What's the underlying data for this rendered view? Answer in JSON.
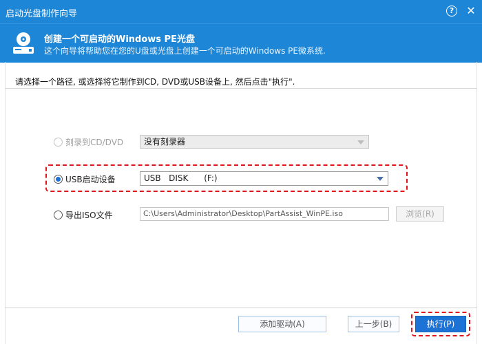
{
  "window": {
    "title": "启动光盘制作向导",
    "help_label": "?",
    "close_label": "✕"
  },
  "header": {
    "title": "创建一个可启动的Windows PE光盘",
    "subtitle": "这个向导将帮助您在您的U盘或光盘上创建一个可启动的Windows PE微系统.",
    "icon": "disc-drive-icon"
  },
  "instruction": "请选择一个路径, 或选择将它制作到CD, DVD或USB设备上, 然后点击\"执行\".",
  "options": {
    "cd_dvd": {
      "label": "刻录到CD/DVD",
      "selected": false,
      "enabled": false,
      "value": "没有刻录器"
    },
    "usb": {
      "label": "USB启动设备",
      "selected": true,
      "enabled": true,
      "value": "USB   DISK      (F:)"
    },
    "iso": {
      "label": "导出ISO文件",
      "selected": false,
      "enabled": true,
      "value": "C:\\Users\\Administrator\\Desktop\\PartAssist_WinPE.iso",
      "browse_label": "浏览(R)"
    }
  },
  "footer": {
    "add_driver_label": "添加驱动(A)",
    "back_label": "上一步(B)",
    "execute_label": "执行(P)"
  },
  "colors": {
    "titlebar": "#1d86d6",
    "primary": "#1d72d6",
    "highlight": "#e0141b"
  }
}
